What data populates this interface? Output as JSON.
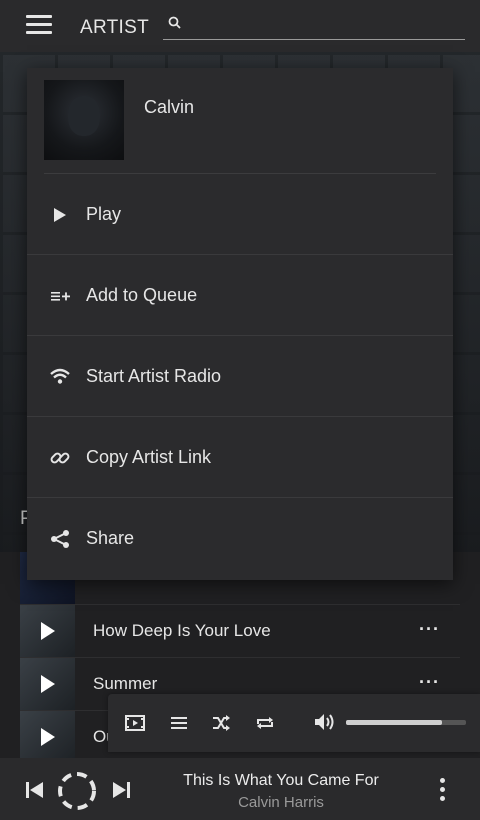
{
  "topbar": {
    "title": "ARTIST",
    "search_placeholder": ""
  },
  "background": {
    "section_label": "P"
  },
  "menu": {
    "artist_name": "Calvin",
    "items": [
      {
        "label": "Play",
        "icon": "play-icon"
      },
      {
        "label": "Add to Queue",
        "icon": "add-to-queue-icon"
      },
      {
        "label": "Start Artist Radio",
        "icon": "radio-icon"
      },
      {
        "label": "Copy Artist Link",
        "icon": "link-icon"
      },
      {
        "label": "Share",
        "icon": "share-icon"
      }
    ]
  },
  "tracks": [
    {
      "name": ""
    },
    {
      "name": "How Deep Is Your Love",
      "more": "···"
    },
    {
      "name": "Summer",
      "more": "···"
    },
    {
      "name": "Ou"
    }
  ],
  "controls": {
    "volume_level": 0.8
  },
  "now_playing": {
    "title": "This Is What You Came For",
    "artist": "Calvin Harris"
  },
  "colors": {
    "background": "#202022",
    "surface": "#2b2b2d",
    "text": "#e6e6e6",
    "muted": "#9a9a9a"
  }
}
